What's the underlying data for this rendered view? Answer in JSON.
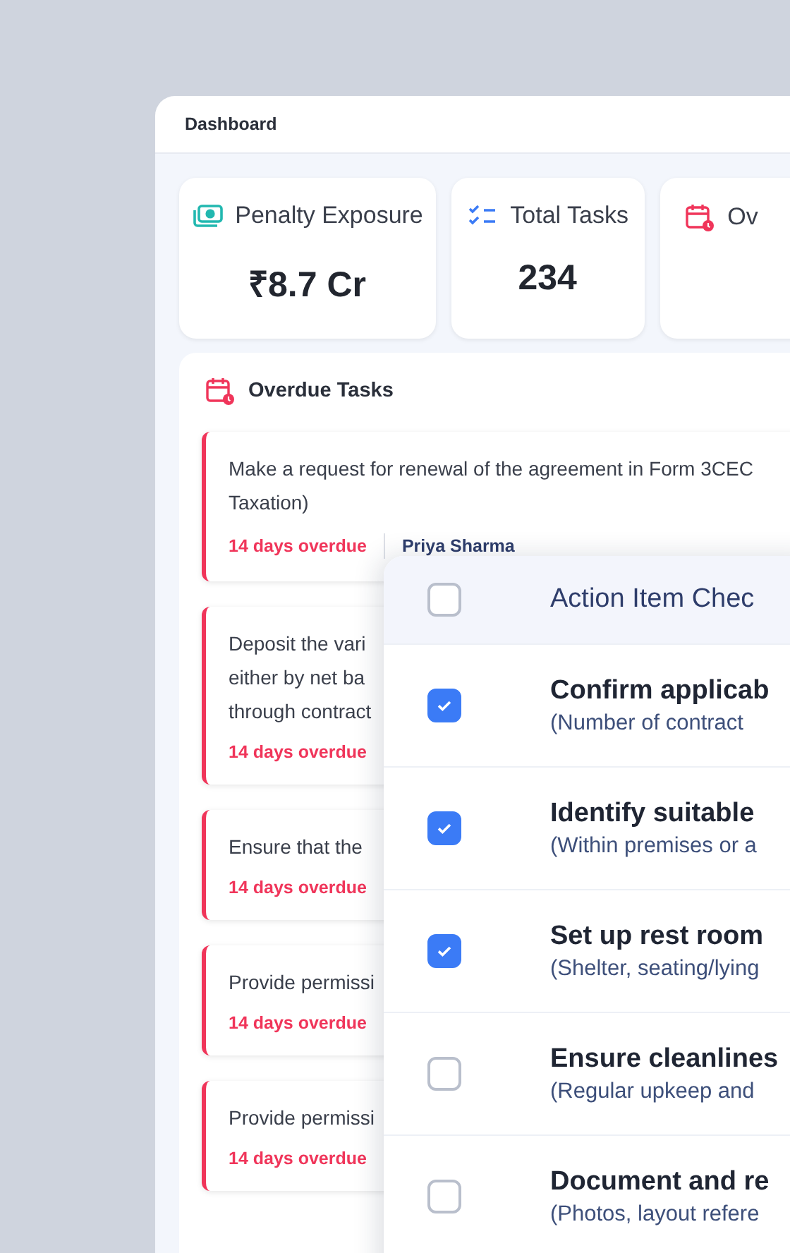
{
  "window": {
    "title": "Dashboard"
  },
  "stats": [
    {
      "kind": "money",
      "label": "Penalty Exposure",
      "value": "₹8.7 Cr"
    },
    {
      "kind": "tasks",
      "label": "Total Tasks",
      "value": "234"
    },
    {
      "kind": "overdue",
      "label": "Ov"
    }
  ],
  "overdue_panel": {
    "title": "Overdue Tasks",
    "tasks": [
      {
        "lines": [
          "Make a request for renewal of the agreement in Form 3CEC",
          "Taxation)"
        ],
        "status": "14 days overdue",
        "assignee": "Priya Sharma"
      },
      {
        "lines": [
          "Deposit the vari",
          "either by net ba",
          "through contract"
        ],
        "status": "14 days overdue"
      },
      {
        "lines": [
          "Ensure that the"
        ],
        "status": "14 days overdue"
      },
      {
        "lines": [
          "Provide permissi"
        ],
        "status": "14 days overdue"
      },
      {
        "lines": [
          "Provide permissi"
        ],
        "status": "14 days overdue"
      }
    ]
  },
  "checklist": {
    "title": "Action Item Chec",
    "checked": false,
    "items": [
      {
        "title": "Confirm applicab",
        "detail": "(Number of contract",
        "checked": true
      },
      {
        "title": "Identify suitable",
        "detail": "(Within premises or a",
        "checked": true
      },
      {
        "title": "Set up rest room",
        "detail": "(Shelter, seating/lying",
        "checked": true
      },
      {
        "title": "Ensure cleanlines",
        "detail": "(Regular upkeep and",
        "checked": false
      },
      {
        "title": "Document and re",
        "detail": "(Photos, layout refere",
        "checked": false
      }
    ]
  }
}
